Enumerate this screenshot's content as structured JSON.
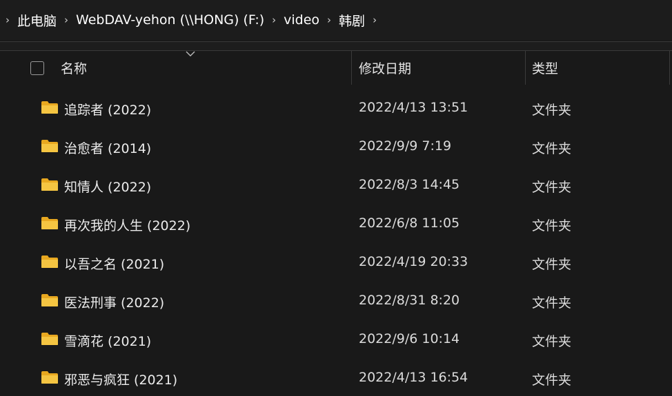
{
  "breadcrumb": [
    {
      "label": "此电脑"
    },
    {
      "label": "WebDAV-yehon (\\\\HONG) (F:)"
    },
    {
      "label": "video"
    },
    {
      "label": "韩剧"
    }
  ],
  "columns": {
    "name": "名称",
    "date": "修改日期",
    "type": "类型"
  },
  "rows": [
    {
      "name": "追踪者 (2022)",
      "date": "2022/4/13 13:51",
      "type": "文件夹"
    },
    {
      "name": "治愈者 (2014)",
      "date": "2022/9/9 7:19",
      "type": "文件夹"
    },
    {
      "name": "知情人 (2022)",
      "date": "2022/8/3 14:45",
      "type": "文件夹"
    },
    {
      "name": "再次我的人生 (2022)",
      "date": "2022/6/8 11:05",
      "type": "文件夹"
    },
    {
      "name": "以吾之名 (2021)",
      "date": "2022/4/19 20:33",
      "type": "文件夹"
    },
    {
      "name": "医法刑事 (2022)",
      "date": "2022/8/31 8:20",
      "type": "文件夹"
    },
    {
      "name": "雪滴花 (2021)",
      "date": "2022/9/6 10:14",
      "type": "文件夹"
    },
    {
      "name": "邪恶与疯狂 (2021)",
      "date": "2022/4/13 16:54",
      "type": "文件夹"
    }
  ],
  "colors": {
    "background": "#191919",
    "folder": "#f5c542",
    "text": "#ffffff"
  },
  "icons": {
    "separator": "chevron-right-icon",
    "folder": "folder-icon",
    "sort": "sort-chevron-icon"
  }
}
